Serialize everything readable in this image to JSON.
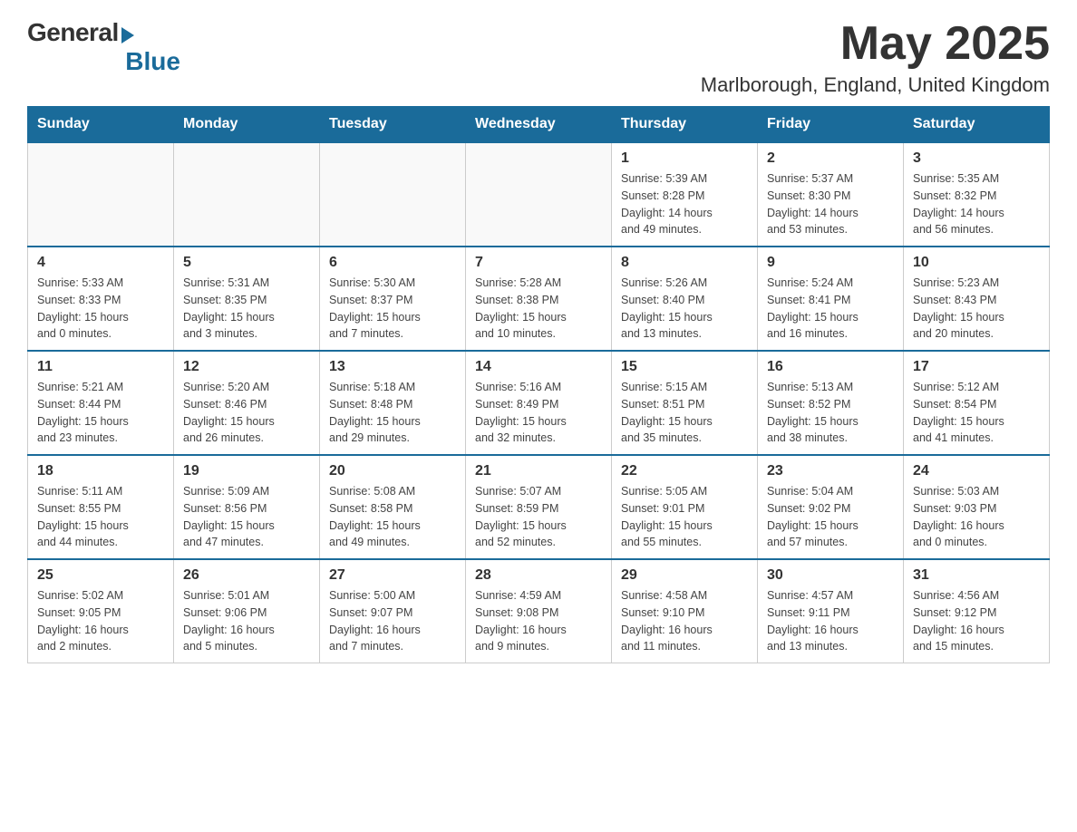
{
  "header": {
    "logo": {
      "general": "General",
      "blue": "Blue"
    },
    "title": "May 2025",
    "location": "Marlborough, England, United Kingdom"
  },
  "calendar": {
    "headers": [
      "Sunday",
      "Monday",
      "Tuesday",
      "Wednesday",
      "Thursday",
      "Friday",
      "Saturday"
    ],
    "weeks": [
      [
        {
          "day": "",
          "info": ""
        },
        {
          "day": "",
          "info": ""
        },
        {
          "day": "",
          "info": ""
        },
        {
          "day": "",
          "info": ""
        },
        {
          "day": "1",
          "info": "Sunrise: 5:39 AM\nSunset: 8:28 PM\nDaylight: 14 hours\nand 49 minutes."
        },
        {
          "day": "2",
          "info": "Sunrise: 5:37 AM\nSunset: 8:30 PM\nDaylight: 14 hours\nand 53 minutes."
        },
        {
          "day": "3",
          "info": "Sunrise: 5:35 AM\nSunset: 8:32 PM\nDaylight: 14 hours\nand 56 minutes."
        }
      ],
      [
        {
          "day": "4",
          "info": "Sunrise: 5:33 AM\nSunset: 8:33 PM\nDaylight: 15 hours\nand 0 minutes."
        },
        {
          "day": "5",
          "info": "Sunrise: 5:31 AM\nSunset: 8:35 PM\nDaylight: 15 hours\nand 3 minutes."
        },
        {
          "day": "6",
          "info": "Sunrise: 5:30 AM\nSunset: 8:37 PM\nDaylight: 15 hours\nand 7 minutes."
        },
        {
          "day": "7",
          "info": "Sunrise: 5:28 AM\nSunset: 8:38 PM\nDaylight: 15 hours\nand 10 minutes."
        },
        {
          "day": "8",
          "info": "Sunrise: 5:26 AM\nSunset: 8:40 PM\nDaylight: 15 hours\nand 13 minutes."
        },
        {
          "day": "9",
          "info": "Sunrise: 5:24 AM\nSunset: 8:41 PM\nDaylight: 15 hours\nand 16 minutes."
        },
        {
          "day": "10",
          "info": "Sunrise: 5:23 AM\nSunset: 8:43 PM\nDaylight: 15 hours\nand 20 minutes."
        }
      ],
      [
        {
          "day": "11",
          "info": "Sunrise: 5:21 AM\nSunset: 8:44 PM\nDaylight: 15 hours\nand 23 minutes."
        },
        {
          "day": "12",
          "info": "Sunrise: 5:20 AM\nSunset: 8:46 PM\nDaylight: 15 hours\nand 26 minutes."
        },
        {
          "day": "13",
          "info": "Sunrise: 5:18 AM\nSunset: 8:48 PM\nDaylight: 15 hours\nand 29 minutes."
        },
        {
          "day": "14",
          "info": "Sunrise: 5:16 AM\nSunset: 8:49 PM\nDaylight: 15 hours\nand 32 minutes."
        },
        {
          "day": "15",
          "info": "Sunrise: 5:15 AM\nSunset: 8:51 PM\nDaylight: 15 hours\nand 35 minutes."
        },
        {
          "day": "16",
          "info": "Sunrise: 5:13 AM\nSunset: 8:52 PM\nDaylight: 15 hours\nand 38 minutes."
        },
        {
          "day": "17",
          "info": "Sunrise: 5:12 AM\nSunset: 8:54 PM\nDaylight: 15 hours\nand 41 minutes."
        }
      ],
      [
        {
          "day": "18",
          "info": "Sunrise: 5:11 AM\nSunset: 8:55 PM\nDaylight: 15 hours\nand 44 minutes."
        },
        {
          "day": "19",
          "info": "Sunrise: 5:09 AM\nSunset: 8:56 PM\nDaylight: 15 hours\nand 47 minutes."
        },
        {
          "day": "20",
          "info": "Sunrise: 5:08 AM\nSunset: 8:58 PM\nDaylight: 15 hours\nand 49 minutes."
        },
        {
          "day": "21",
          "info": "Sunrise: 5:07 AM\nSunset: 8:59 PM\nDaylight: 15 hours\nand 52 minutes."
        },
        {
          "day": "22",
          "info": "Sunrise: 5:05 AM\nSunset: 9:01 PM\nDaylight: 15 hours\nand 55 minutes."
        },
        {
          "day": "23",
          "info": "Sunrise: 5:04 AM\nSunset: 9:02 PM\nDaylight: 15 hours\nand 57 minutes."
        },
        {
          "day": "24",
          "info": "Sunrise: 5:03 AM\nSunset: 9:03 PM\nDaylight: 16 hours\nand 0 minutes."
        }
      ],
      [
        {
          "day": "25",
          "info": "Sunrise: 5:02 AM\nSunset: 9:05 PM\nDaylight: 16 hours\nand 2 minutes."
        },
        {
          "day": "26",
          "info": "Sunrise: 5:01 AM\nSunset: 9:06 PM\nDaylight: 16 hours\nand 5 minutes."
        },
        {
          "day": "27",
          "info": "Sunrise: 5:00 AM\nSunset: 9:07 PM\nDaylight: 16 hours\nand 7 minutes."
        },
        {
          "day": "28",
          "info": "Sunrise: 4:59 AM\nSunset: 9:08 PM\nDaylight: 16 hours\nand 9 minutes."
        },
        {
          "day": "29",
          "info": "Sunrise: 4:58 AM\nSunset: 9:10 PM\nDaylight: 16 hours\nand 11 minutes."
        },
        {
          "day": "30",
          "info": "Sunrise: 4:57 AM\nSunset: 9:11 PM\nDaylight: 16 hours\nand 13 minutes."
        },
        {
          "day": "31",
          "info": "Sunrise: 4:56 AM\nSunset: 9:12 PM\nDaylight: 16 hours\nand 15 minutes."
        }
      ]
    ]
  }
}
